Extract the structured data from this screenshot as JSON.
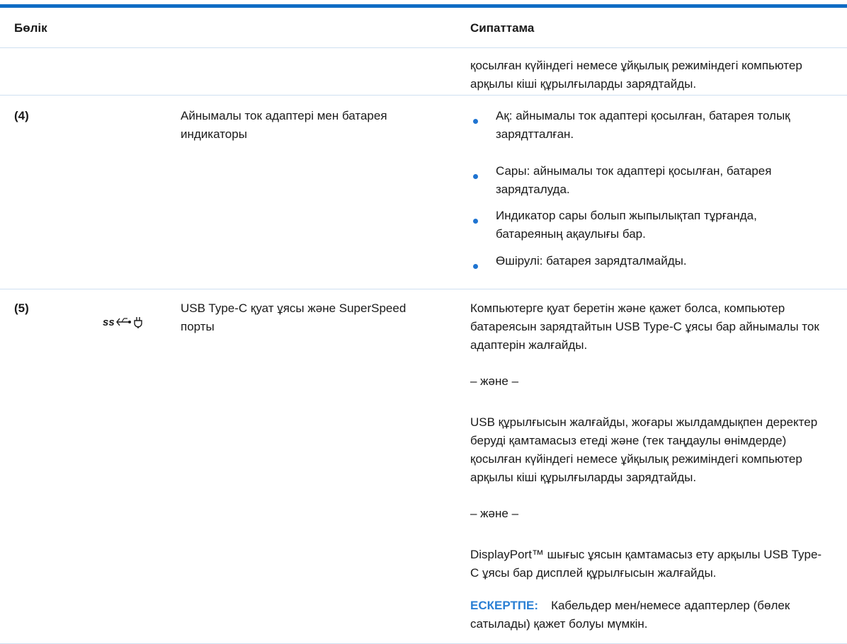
{
  "header": {
    "part_label": "Бөлік",
    "desc_label": "Сипаттама"
  },
  "rows": [
    {
      "part": "",
      "name": "",
      "desc": "қосылған күйіндегі немесе ұйқылық режиміндегі компьютер арқылы кіші құрылғыларды зарядтайды."
    },
    {
      "part": "(4)",
      "name": "Айнымалы ток адаптері мен батарея индикаторы",
      "bullets": [
        "Ақ: айнымалы ток адаптері қосылған, батарея толық зарядтталған.",
        "Сары: айнымалы ток адаптері қосылған, батарея зарядталуда.",
        "Индикатор сары болып жыпылықтап тұрғанда, батареяның ақаулығы бар.",
        "Өшірулі: батарея зарядталмайды."
      ]
    },
    {
      "part": "(5)",
      "icon": "usb-superspeed-power-icon",
      "icon_text": "SS",
      "name": "USB Type-C қуат ұясы және SuperSpeed порты",
      "paragraphs": [
        "Компьютерге қуат беретін және қажет болса, компьютер батареясын зарядтайтын USB Type-C ұясы бар айнымалы ток адаптерін жалғайды.",
        "– және –",
        "USB құрылғысын жалғайды, жоғары жылдамдықпен деректер беруді қамтамасыз етеді және (тек таңдаулы өнімдерде) қосылған күйіндегі немесе ұйқылық режиміндегі компьютер арқылы кіші құрылғыларды зарядтайды.",
        "– және –",
        "DisplayPort™ шығыс ұясын қамтамасыз ету арқылы USB Type-C ұясы бар дисплей құрылғысын жалғайды."
      ],
      "note_label": "ЕСКЕРТПЕ:",
      "note_text": "Кабельдер мен/немесе адаптерлер (бөлек сатылады) қажет болуы мүмкін."
    }
  ],
  "colors": {
    "accent": "#0f6cc4",
    "bullet": "#1f74d1",
    "note": "#2a7fd4",
    "rule": "#cfe0f1"
  }
}
